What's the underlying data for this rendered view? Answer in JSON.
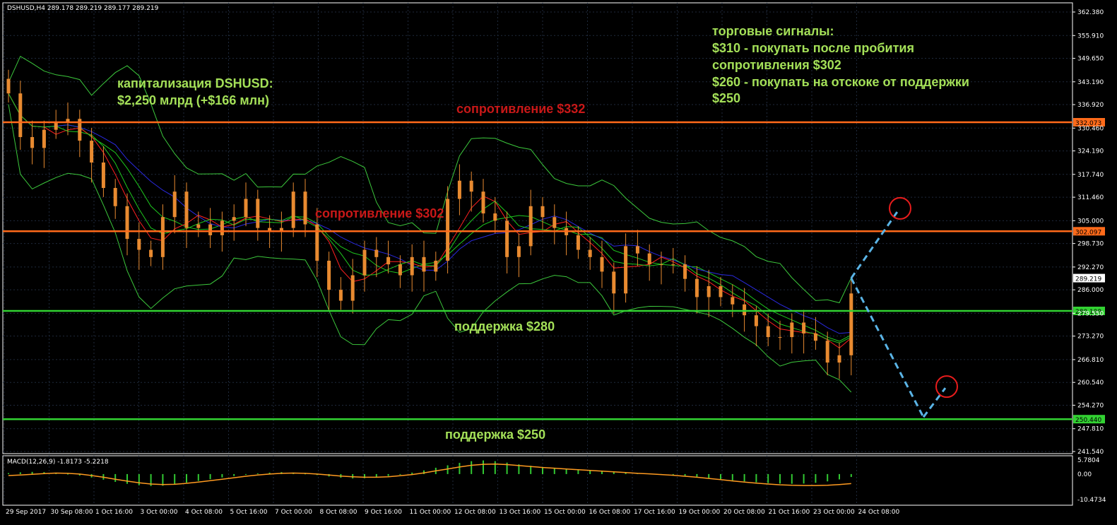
{
  "title": "DSHUSD,H4  289.178 289.219 289.177 289.219",
  "macd_title": "MACD(12,26,9) -1.8173 -5.2218",
  "annotations": {
    "cap_label": "капитализация DSHUSD:",
    "cap_value": "$2,250 млрд (+$166 млн)",
    "signals": [
      "торговые сигналы:",
      "$310 - покупать после пробития",
      "сопротивления $302",
      "$260 - покупать на отскоке от поддержки",
      "$250"
    ],
    "resistance_332": "сопротивление $332",
    "resistance_302": "сопротивление $302",
    "support_280": "поддержка $280",
    "support_250": "поддержка $250"
  },
  "colors": {
    "background": "#000000",
    "frame": "#ffffff",
    "grid": "#1f2a3c",
    "candle": "#e88a30",
    "resistance_line": "#ff6a1a",
    "support_line": "#32d232",
    "forecast": "#5ab4e6",
    "circle": "#e81c1c",
    "bollinger": "#3cc83c",
    "ma_fast": "#ff2020",
    "ma_mid": "#2a2ae0",
    "ma_green": "#1ec81e",
    "macd_hist": "#32c832",
    "macd_signal": "#ff9a20"
  },
  "chart_data": [
    {
      "type": "candlestick",
      "symbol": "DSHUSD",
      "timeframe": "H4",
      "ylim": [
        241.54,
        362.38
      ],
      "y_ticks": [
        "362.380",
        "355.910",
        "349.650",
        "343.190",
        "336.920",
        "330.460",
        "324.190",
        "317.740",
        "311.460",
        "305.000",
        "298.730",
        "292.270",
        "286.000",
        "279.550",
        "273.270",
        "266.810",
        "260.540",
        "254.270",
        "247.810",
        "241.540"
      ],
      "x_ticks": [
        "29 Sep 2017",
        "30 Sep 08:00",
        "1 Oct 16:00",
        "3 Oct 00:00",
        "4 Oct 08:00",
        "5 Oct 16:00",
        "7 Oct 00:00",
        "8 Oct 08:00",
        "9 Oct 16:00",
        "11 Oct 00:00",
        "12 Oct 08:00",
        "13 Oct 16:00",
        "15 Oct 00:00",
        "16 Oct 08:00",
        "17 Oct 16:00",
        "19 Oct 00:00",
        "20 Oct 08:00",
        "21 Oct 16:00",
        "23 Oct 00:00",
        "24 Oct 08:00"
      ],
      "closes": [
        340,
        328,
        325,
        330,
        332,
        333,
        327,
        321,
        314,
        309,
        300,
        297,
        295,
        306,
        313,
        303,
        304,
        301,
        305,
        306,
        311,
        303,
        302,
        303,
        313,
        304,
        294,
        286,
        283,
        290,
        297,
        295,
        293,
        290,
        295,
        291,
        294,
        311,
        316,
        313,
        307,
        305,
        295,
        298,
        309,
        306,
        303,
        301,
        297,
        295,
        291,
        285,
        298,
        296,
        293,
        293,
        293,
        289,
        284,
        287,
        284,
        282,
        279,
        276,
        273,
        273,
        277,
        274,
        272,
        266,
        268,
        285
      ],
      "levels": [
        {
          "name": "resistance",
          "value": 332.073,
          "label": "332.073"
        },
        {
          "name": "resistance",
          "value": 302.097,
          "label": "302.097"
        },
        {
          "name": "support",
          "value": 280.199,
          "label": "280.199"
        },
        {
          "name": "support",
          "value": 250.44,
          "label": "250.440"
        }
      ],
      "last_price": {
        "value": 289.219,
        "label": "289.219"
      },
      "forecast_path": [
        {
          "from": 289.2,
          "to": 308.0,
          "direction": "up"
        },
        {
          "from": 289.2,
          "to": 251.0,
          "direction": "down-then-up",
          "end": 259.0
        }
      ]
    },
    {
      "type": "macd",
      "name": "MACD(12,26,9)",
      "values": {
        "macd": -1.8173,
        "signal": -5.2218
      },
      "ylim": [
        -10.4734,
        5.7804
      ],
      "y_ticks": [
        "5.7804",
        "0.00",
        "-10.4734"
      ],
      "histogram": [
        0.4,
        0.7,
        0.9,
        0.8,
        0.5,
        0.1,
        -0.6,
        -1.4,
        -2.3,
        -3.2,
        -4.0,
        -4.6,
        -4.9,
        -4.8,
        -4.2,
        -3.5,
        -2.8,
        -2.1,
        -1.4,
        -0.8,
        -0.2,
        0.3,
        0.6,
        0.8,
        0.6,
        0.2,
        -0.4,
        -1.0,
        -1.5,
        -1.8,
        -1.7,
        -1.3,
        -0.8,
        -0.2,
        0.6,
        1.5,
        2.6,
        3.6,
        4.6,
        5.3,
        5.6,
        5.3,
        4.7,
        4.0,
        3.4,
        2.9,
        2.5,
        2.2,
        1.9,
        1.6,
        1.3,
        0.9,
        0.6,
        0.4,
        0.2,
        0.0,
        -0.3,
        -0.7,
        -1.1,
        -1.6,
        -2.1,
        -2.6,
        -3.0,
        -3.4,
        -3.7,
        -3.9,
        -4.0,
        -3.9,
        -3.6,
        -3.0,
        -2.2,
        -1.2
      ],
      "signal_line": [
        -0.6,
        -0.4,
        -0.1,
        0.2,
        0.4,
        0.3,
        0.0,
        -0.6,
        -1.3,
        -2.1,
        -2.9,
        -3.6,
        -4.1,
        -4.3,
        -4.2,
        -3.8,
        -3.3,
        -2.7,
        -2.1,
        -1.5,
        -0.9,
        -0.4,
        0.0,
        0.3,
        0.4,
        0.3,
        0.0,
        -0.4,
        -0.8,
        -1.1,
        -1.3,
        -1.3,
        -1.1,
        -0.7,
        -0.2,
        0.5,
        1.3,
        2.1,
        2.9,
        3.6,
        4.0,
        4.1,
        3.9,
        3.5,
        3.1,
        2.7,
        2.4,
        2.1,
        1.8,
        1.5,
        1.2,
        0.9,
        0.6,
        0.3,
        0.1,
        -0.2,
        -0.5,
        -0.9,
        -1.3,
        -1.8,
        -2.3,
        -2.8,
        -3.3,
        -3.7,
        -4.1,
        -4.4,
        -4.6,
        -4.7,
        -4.7,
        -4.6,
        -4.3,
        -3.9
      ]
    }
  ]
}
